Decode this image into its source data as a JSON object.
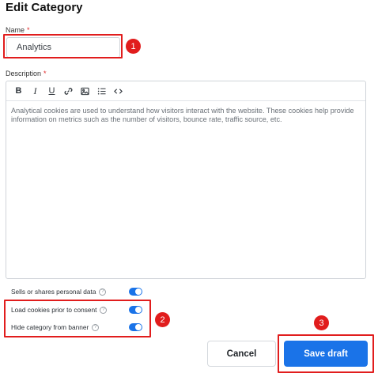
{
  "dialog": {
    "title": "Edit Category"
  },
  "name_field": {
    "label": "Name",
    "required_mark": "*",
    "value": "Analytics"
  },
  "description_field": {
    "label": "Description",
    "required_mark": "*",
    "toolbar": [
      "bold-icon",
      "italic-icon",
      "underline-icon",
      "link-icon",
      "image-icon",
      "bulleted-list-icon",
      "code-icon"
    ],
    "text": "Analytical cookies are used to understand how visitors interact with the website. These cookies help provide information on metrics such as the number of visitors, bounce rate, traffic source, etc."
  },
  "toggles": [
    {
      "label": "Sells or shares personal data",
      "help": "?",
      "on": true
    },
    {
      "label": "Load cookies prior to consent",
      "help": "?",
      "on": true
    },
    {
      "label": "Hide category from banner",
      "help": "?",
      "on": true
    }
  ],
  "buttons": {
    "cancel": "Cancel",
    "save": "Save draft"
  },
  "annotations": [
    "1",
    "2",
    "3"
  ],
  "colors": {
    "accent": "#1a73e8",
    "annotation": "#e11d1d"
  }
}
